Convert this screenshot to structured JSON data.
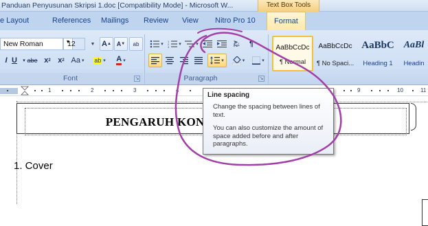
{
  "window": {
    "title": "Panduan Penyusunan Skripsi 1.doc [Compatibility Mode] - Microsoft W...",
    "contextual_tab_group": "Text Box Tools"
  },
  "tabs": [
    {
      "label": "e Layout"
    },
    {
      "label": "References"
    },
    {
      "label": "Mailings"
    },
    {
      "label": "Review"
    },
    {
      "label": "View"
    },
    {
      "label": "Nitro Pro 10"
    },
    {
      "label": "Format",
      "active": true
    }
  ],
  "font_group": {
    "font_name": "New Roman",
    "font_size": "12",
    "label": "Font",
    "buttons": {
      "grow": "A",
      "shrink": "A",
      "clear": "ab",
      "italic": "I",
      "underline": "U",
      "strike": "abe",
      "subscript": "x",
      "superscript": "x",
      "change_case": "Aa",
      "highlight": "ab",
      "font_color": "A"
    }
  },
  "paragraph_group": {
    "label": "Paragraph",
    "sort_icon": "AZ",
    "pilcrow": "¶"
  },
  "styles": [
    {
      "sample": "AaBbCcDc",
      "name": "¶ Normal",
      "selected": true
    },
    {
      "sample": "AaBbCcDc",
      "name": "¶ No Spaci..."
    },
    {
      "sample": "AaBbC",
      "name": "Heading 1"
    },
    {
      "sample": "AaBl",
      "name": "Headin"
    }
  ],
  "ruler": {
    "numbers_left": [
      "1",
      "2",
      "3",
      "4"
    ],
    "numbers_right": [
      "9",
      "10",
      "11"
    ]
  },
  "tooltip": {
    "title": "Line spacing",
    "body1": "Change the spacing between lines of text.",
    "body2": "You can also customize the amount of space added before and after paragraphs."
  },
  "document": {
    "heading": "1.  Cover",
    "textbox_title": "PENGARUH KONSEP DIRI TERHADAP"
  },
  "colors": {
    "ribbon": "#cfdff4",
    "format_tab": "#fde9a9",
    "annotation": "#a33ea8",
    "highlight_button": "#ffd87a"
  }
}
